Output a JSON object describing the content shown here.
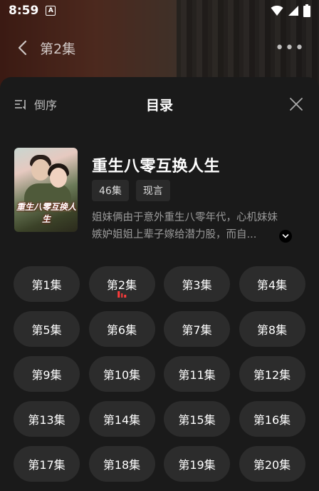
{
  "status_bar": {
    "time": "8:59",
    "app_badge": "A"
  },
  "top_nav": {
    "title": "第2集",
    "more_label": "•••"
  },
  "sheet": {
    "sort_label": "倒序",
    "title": "目录"
  },
  "drama": {
    "title": "重生八零互换人生",
    "poster_text": "重生八零互换人生",
    "tags": [
      "46集",
      "现言"
    ],
    "description_lines": [
      "姐妹俩由于意外重生八零年代，心机妹妹",
      "嫉妒姐姐上辈子嫁给潜力股，而自..."
    ]
  },
  "episodes": [
    "第1集",
    "第2集",
    "第3集",
    "第4集",
    "第5集",
    "第6集",
    "第7集",
    "第8集",
    "第9集",
    "第10集",
    "第11集",
    "第12集",
    "第13集",
    "第14集",
    "第15集",
    "第16集",
    "第17集",
    "第18集",
    "第19集",
    "第20集"
  ],
  "current_episode_index": 1,
  "colors": {
    "accent": "#ff3b3b",
    "sheet_bg": "#1a1a1a",
    "pill_bg": "#2c2c2c"
  }
}
